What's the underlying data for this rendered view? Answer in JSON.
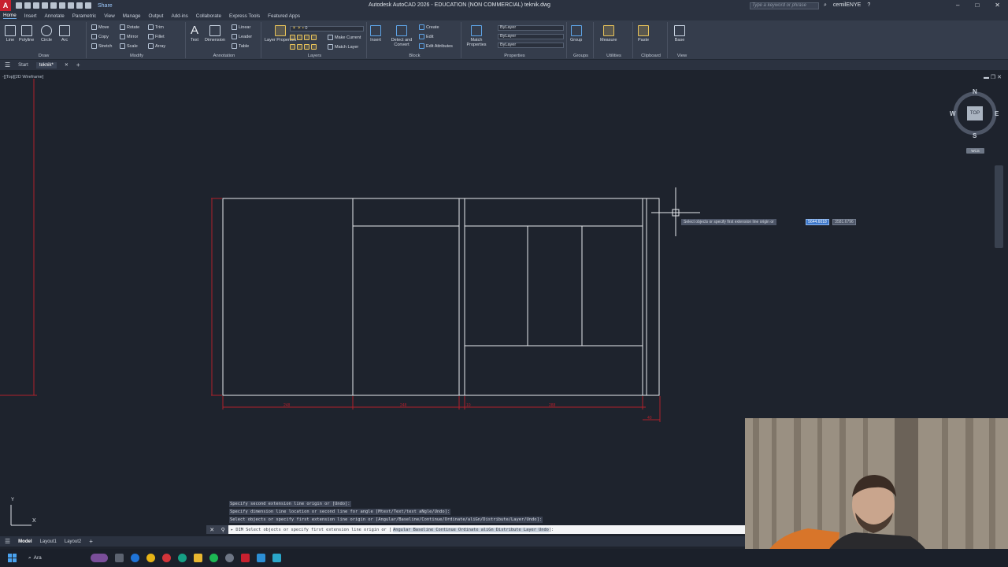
{
  "titlebar": {
    "app_logo": "A",
    "share": "Share",
    "title": "Autodesk AutoCAD 2026 - EDUCATION (NON COMMERCIAL)   teknik.dwg",
    "search_placeholder": "Type a keyword or phrase",
    "user": "cemilENYE",
    "controls": [
      "–",
      "□",
      "✕"
    ]
  },
  "ribbon_tabs": [
    "Home",
    "Insert",
    "Annotate",
    "Parametric",
    "View",
    "Manage",
    "Output",
    "Add-ins",
    "Collaborate",
    "Express Tools",
    "Featured Apps"
  ],
  "ribbon": {
    "draw": {
      "label": "Draw",
      "tools": [
        "Line",
        "Polyline",
        "Circle",
        "Arc"
      ]
    },
    "modify": {
      "label": "Modify",
      "tools": [
        "Move",
        "Rotate",
        "Trim",
        "Copy",
        "Mirror",
        "Fillet",
        "Stretch",
        "Scale",
        "Array"
      ]
    },
    "annotation": {
      "label": "Annotation",
      "tools": [
        "Text",
        "Dimension",
        "Linear",
        "Leader",
        "Table"
      ]
    },
    "layers": {
      "label": "Layers",
      "tools": [
        "Layer Properties",
        "Make Current",
        "Match Layer"
      ],
      "current_layer": "0"
    },
    "block": {
      "label": "Block",
      "tools": [
        "Insert",
        "Create",
        "Edit",
        "Edit Attributes"
      ]
    },
    "detect": "Detect and Convert",
    "properties": {
      "label": "Properties",
      "match": "Match Properties",
      "values": [
        "ByLayer",
        "ByLayer",
        "ByLayer"
      ]
    },
    "groups": {
      "label": "Groups",
      "tool": "Group"
    },
    "utilities": {
      "label": "Utilities",
      "tool": "Measure"
    },
    "clipboard": {
      "label": "Clipboard",
      "tool": "Paste"
    },
    "view": {
      "label": "View",
      "tool": "Base"
    }
  },
  "file_tabs": [
    "Start",
    "teknik*"
  ],
  "viewport_label": "-][Top][2D Wireframe]",
  "viewcube": {
    "n": "N",
    "s": "S",
    "e": "E",
    "w": "W",
    "face": "TOP",
    "wcs": "WCS"
  },
  "tooltip": {
    "prompt": "Select objects or specify first extension line origin or",
    "value1": "5644.6018",
    "value2": "3581.6796"
  },
  "dimension_labels": [
    "248",
    "248",
    "10",
    "288",
    "40"
  ],
  "command_history": [
    "Specify second extension line origin or [Undo]:",
    "Specify dimension line location or second line for angle [Mtext/Text/text aNgle/Undo]:",
    "Select objects or specify first extension line origin or [Angular/Baseline/Continue/Ordinate/aliGn/Distribute/Layer/Undo]:"
  ],
  "command_line": {
    "prefix": "▸ DIM Select objects or specify first extension line origin or [",
    "options": "Angular Baseline Continue Ordinate aliGn Distribute Layer Undo",
    "suffix": "]:"
  },
  "layout_tabs": [
    "Model",
    "Layout1",
    "Layout2"
  ],
  "ucs": {
    "y": "Y",
    "x": "X"
  },
  "taskbar": {
    "search": "Ara"
  }
}
